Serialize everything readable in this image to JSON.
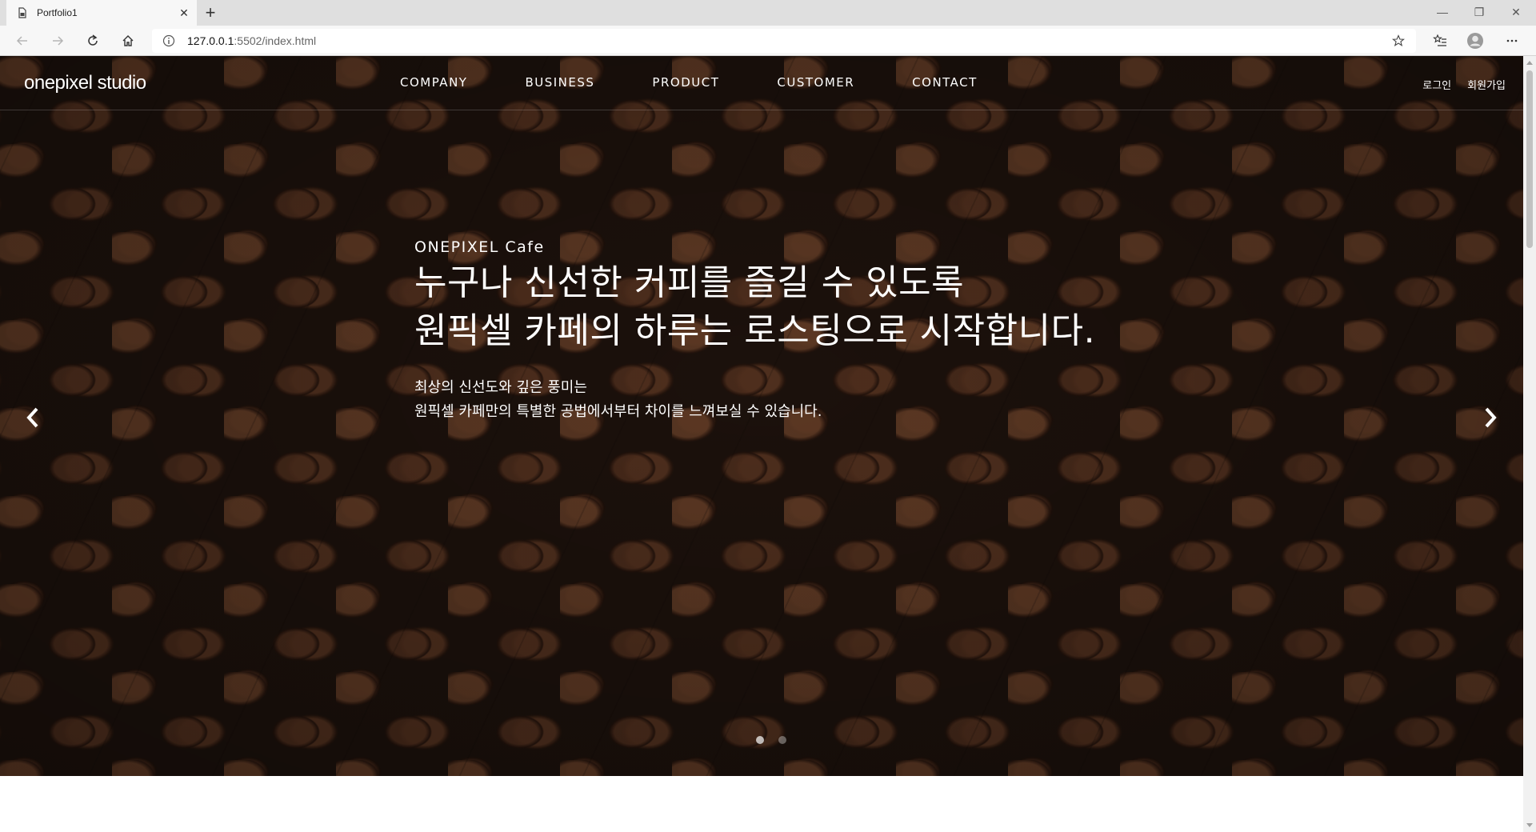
{
  "browser": {
    "tab_title": "Portfolio1",
    "tab_close": "✕",
    "new_tab": "+",
    "url_host": "127.0.0.1",
    "url_path": ":5502/index.html",
    "window_controls": {
      "minimize": "—",
      "restore": "❐",
      "close": "✕"
    },
    "icons": {
      "favicon": "document-icon",
      "back": "back-arrow-icon",
      "forward": "forward-arrow-icon",
      "refresh": "refresh-icon",
      "home": "home-icon",
      "info": "info-icon",
      "favorite": "star-icon",
      "favorites": "favorites-icon",
      "profile": "profile-icon",
      "more": "more-icon"
    }
  },
  "site": {
    "logo": "onepixel studio",
    "nav": [
      "COMPANY",
      "BUSINESS",
      "PRODUCT",
      "CUSTOMER",
      "CONTACT"
    ],
    "util": {
      "login": "로그인",
      "signup": "회원가입"
    }
  },
  "hero": {
    "eyebrow": "ONEPIXEL Cafe",
    "headline_1": "누구나 신선한 커피를 즐길 수 있도록",
    "headline_2": "원픽셀 카페의 하루는 로스팅으로 시작합니다.",
    "desc_1": "최상의 신선도와 깊은 풍미는",
    "desc_2": "원픽셀 카페만의 특별한 공법에서부터 차이를 느껴보실 수 있습니다.",
    "slide_count": 2,
    "active_slide": 1
  },
  "colors": {
    "hero_text": "#ffffff",
    "coffee_base": "#2a1a12"
  }
}
